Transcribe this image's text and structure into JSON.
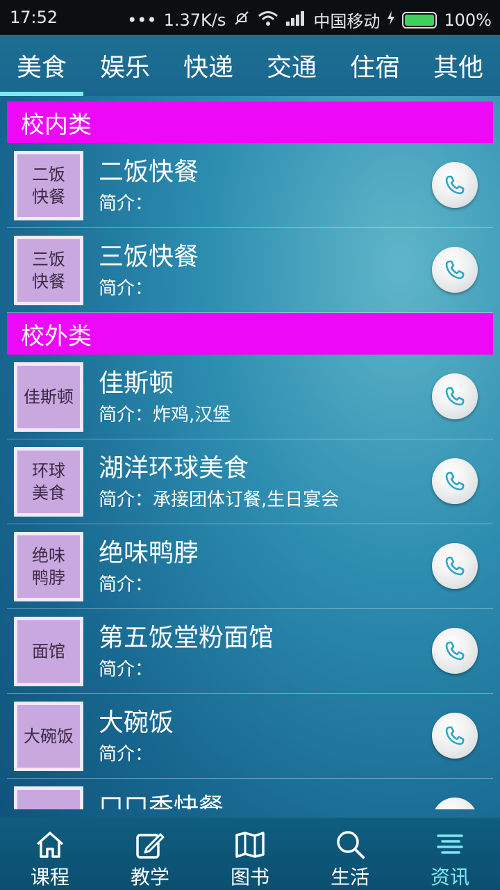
{
  "status": {
    "time": "17:52",
    "dots": "•••",
    "speed": "1.37K/s",
    "carrier": "中国移动",
    "battery": "100%"
  },
  "top_tabs": [
    "美食",
    "娱乐",
    "快递",
    "交通",
    "住宿",
    "其他"
  ],
  "active_top_tab": 0,
  "sections": [
    {
      "title": "校内类",
      "items": [
        {
          "thumb": [
            "二饭",
            "快餐"
          ],
          "name": "二饭快餐",
          "desc_label": "简介：",
          "desc": ""
        },
        {
          "thumb": [
            "三饭",
            "快餐"
          ],
          "name": "三饭快餐",
          "desc_label": "简介：",
          "desc": ""
        }
      ]
    },
    {
      "title": "校外类",
      "items": [
        {
          "thumb": [
            "佳斯顿"
          ],
          "name": "佳斯顿",
          "desc_label": "简介：",
          "desc": "炸鸡,汉堡"
        },
        {
          "thumb": [
            "环球",
            "美食"
          ],
          "name": "湖洋环球美食",
          "desc_label": "简介：",
          "desc": "承接团体订餐,生日宴会"
        },
        {
          "thumb": [
            "绝味",
            "鸭脖"
          ],
          "name": "绝味鸭脖",
          "desc_label": "简介：",
          "desc": ""
        },
        {
          "thumb": [
            "面馆"
          ],
          "name": "第五饭堂粉面馆",
          "desc_label": "简介：",
          "desc": ""
        },
        {
          "thumb": [
            "大碗饭"
          ],
          "name": "大碗饭",
          "desc_label": "简介：",
          "desc": ""
        },
        {
          "thumb": [
            ""
          ],
          "name": "口口香快餐",
          "desc_label": "简介：",
          "desc": ""
        }
      ]
    }
  ],
  "bottom_tabs": [
    {
      "label": "课程",
      "icon": "home-icon"
    },
    {
      "label": "教学",
      "icon": "edit-icon"
    },
    {
      "label": "图书",
      "icon": "map-book-icon"
    },
    {
      "label": "生活",
      "icon": "search-icon"
    },
    {
      "label": "资讯",
      "icon": "news-icon"
    }
  ],
  "active_bottom_tab": 4,
  "colors": {
    "section_header": "#ee08f8",
    "active_accent": "#7fe7f2",
    "thumb_bg": "#c9a8e0"
  }
}
